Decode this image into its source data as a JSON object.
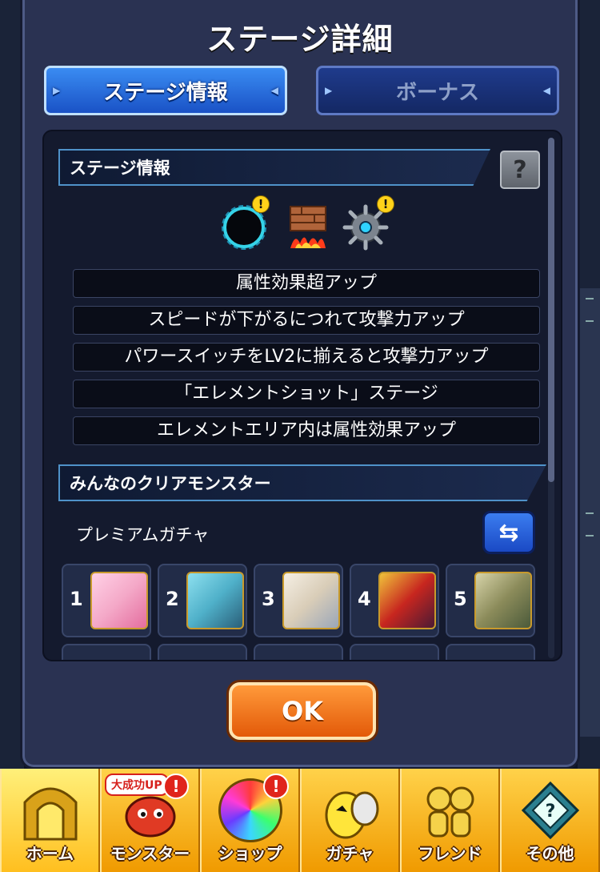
{
  "modal": {
    "title": "ステージ詳細",
    "tabs": [
      {
        "label": "ステージ情報",
        "active": true
      },
      {
        "label": "ボーナス",
        "active": false
      }
    ]
  },
  "stage_info": {
    "section_title": "ステージ情報",
    "help_label": "?",
    "gimmick_icons": [
      {
        "name": "black-hole-icon",
        "warning": true
      },
      {
        "name": "damage-wall-icon",
        "warning": false
      },
      {
        "name": "mine-icon",
        "warning": true
      }
    ],
    "warning_glyph": "!",
    "effects": [
      "属性効果超アップ",
      "スピードが下がるにつれて攻撃力アップ",
      "パワースイッチをLV2に揃えると攻撃力アップ",
      "「エレメントショット」ステージ",
      "エレメントエリア内は属性効果アップ"
    ]
  },
  "clear_monsters": {
    "section_title": "みんなのクリアモンスター",
    "source_label": "プレミアムガチャ",
    "swap_glyph": "⇆",
    "ranks": [
      {
        "num": "1",
        "color": "#f4a9c8"
      },
      {
        "num": "2",
        "color": "#4fb0c9"
      },
      {
        "num": "3",
        "color": "#d9cdb8"
      },
      {
        "num": "4",
        "color": "#c7261f"
      },
      {
        "num": "5",
        "color": "#8b8b5a"
      }
    ]
  },
  "ok_label": "OK",
  "nav": {
    "items": [
      {
        "label": "ホーム",
        "icon": "home-gate-icon",
        "active": true
      },
      {
        "label": "モンスター",
        "icon": "monster-dragon-icon",
        "active": false,
        "ribbon": "大成功UP",
        "badge": "!"
      },
      {
        "label": "ショップ",
        "icon": "orb-icon",
        "active": false,
        "badge": "!"
      },
      {
        "label": "ガチャ",
        "icon": "gacha-egg-icon",
        "active": false
      },
      {
        "label": "フレンド",
        "icon": "friend-icon",
        "active": false
      },
      {
        "label": "その他",
        "icon": "other-menu-icon",
        "active": false
      }
    ]
  },
  "colors": {
    "modal_bg": "#2a3252",
    "tab_active": "#2a6ee0",
    "ok_button": "#f07a1a",
    "nav_bg": "#ffb300"
  }
}
